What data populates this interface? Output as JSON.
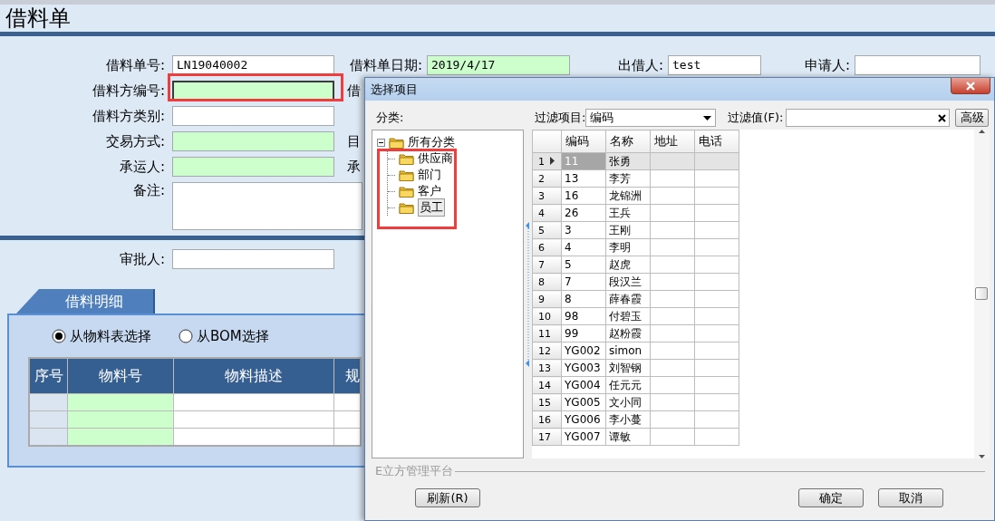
{
  "form": {
    "title": "借料单",
    "rows": [
      [
        {
          "kind": "input",
          "label": "借料单号:",
          "value": "LN19040002",
          "required": false
        },
        {
          "kind": "input",
          "label": "借料单日期:",
          "value": "2019/4/17",
          "required": true
        },
        {
          "kind": "input",
          "label": "出借人:",
          "value": "test",
          "required": false
        },
        {
          "kind": "input",
          "label": "申请人:",
          "required": false
        }
      ],
      [
        {
          "kind": "input",
          "label": "借料方编号:",
          "required": true,
          "highlighted": true
        },
        {
          "kind": "label",
          "label": "借"
        }
      ],
      [
        {
          "kind": "input",
          "label": "借料方类别:",
          "required": false
        }
      ],
      [
        {
          "kind": "input",
          "label": "交易方式:",
          "required": true
        },
        {
          "kind": "label",
          "label": "目"
        }
      ],
      [
        {
          "kind": "input",
          "label": "承运人:",
          "required": true
        },
        {
          "kind": "label",
          "label": "承"
        }
      ],
      [
        {
          "kind": "textarea",
          "label": "备注:",
          "required": false
        }
      ]
    ],
    "approval": [
      {
        "kind": "input",
        "label": "审批人:",
        "required": false
      }
    ],
    "detail": {
      "tab": "借料明细",
      "sources": [
        {
          "label": "从物料表选择",
          "selected": true
        },
        {
          "label": "从BOM选择",
          "selected": false
        }
      ],
      "columns": [
        {
          "label": "序号",
          "kind": "index"
        },
        {
          "label": "物料号",
          "kind": "required"
        },
        {
          "label": "物料描述",
          "kind": "text"
        },
        {
          "label": "规",
          "kind": "cut"
        }
      ]
    }
  },
  "dialog": {
    "title": "选择项目",
    "category_label": "分类:",
    "tree": {
      "label": "所有分类",
      "expanded": true,
      "highlighted": true,
      "children": [
        {
          "label": "供应商",
          "selected": false
        },
        {
          "label": "部门",
          "selected": false
        },
        {
          "label": "客户",
          "selected": false
        },
        {
          "label": "员工",
          "selected": true
        }
      ]
    },
    "filter_label": "过滤项目:",
    "filter_value": "编码",
    "value_label": "过滤值(F):",
    "advanced_button": "高级",
    "grid": {
      "columns": [
        "编码",
        "名称",
        "地址",
        "电话"
      ],
      "rows": [
        {
          "number": "1",
          "code": "11",
          "name": "张勇",
          "selected": true
        },
        {
          "number": "2",
          "code": "13",
          "name": "李芳",
          "selected": false
        },
        {
          "number": "3",
          "code": "16",
          "name": "龙锦洲",
          "selected": false
        },
        {
          "number": "4",
          "code": "26",
          "name": "王兵",
          "selected": false
        },
        {
          "number": "5",
          "code": "3",
          "name": "王刚",
          "selected": false
        },
        {
          "number": "6",
          "code": "4",
          "name": "李明",
          "selected": false
        },
        {
          "number": "7",
          "code": "5",
          "name": "赵虎",
          "selected": false
        },
        {
          "number": "8",
          "code": "7",
          "name": "段汉兰",
          "selected": false
        },
        {
          "number": "9",
          "code": "8",
          "name": "薛春霞",
          "selected": false
        },
        {
          "number": "10",
          "code": "98",
          "name": "付碧玉",
          "selected": false
        },
        {
          "number": "11",
          "code": "99",
          "name": "赵粉霞",
          "selected": false
        },
        {
          "number": "12",
          "code": "YG002",
          "name": "simon",
          "selected": false
        },
        {
          "number": "13",
          "code": "YG003",
          "name": "刘智钢",
          "selected": false
        },
        {
          "number": "14",
          "code": "YG004",
          "name": "任元元",
          "selected": false
        },
        {
          "number": "15",
          "code": "YG005",
          "name": "文小同",
          "selected": false
        },
        {
          "number": "16",
          "code": "YG006",
          "name": "李小蔓",
          "selected": false
        },
        {
          "number": "17",
          "code": "YG007",
          "name": "谭敏",
          "selected": false
        }
      ]
    },
    "group_label": "E立方管理平台",
    "buttons": [
      {
        "label": "刷新(R)",
        "kind": "refresh"
      },
      {
        "label": "确定",
        "kind": "ok"
      },
      {
        "label": "取消",
        "kind": "cancel"
      }
    ]
  }
}
